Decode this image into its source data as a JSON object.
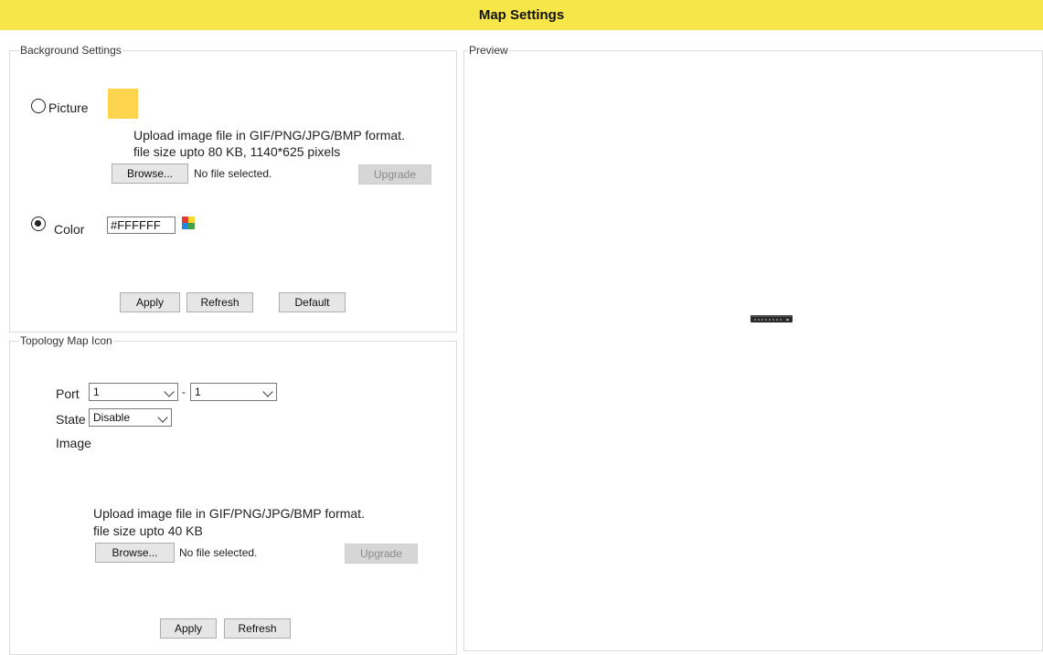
{
  "title": "Map Settings",
  "background": {
    "legend": "Background Settings",
    "picture_label": "Picture",
    "picture_swatch_color": "#ffd54f",
    "upload_note_line1": "Upload image file in GIF/PNG/JPG/BMP format.",
    "upload_note_line2": "file size upto 80 KB, 1140*625 pixels",
    "browse_label": "Browse...",
    "no_file_text": "No file selected.",
    "upgrade_label": "Upgrade",
    "color_label": "Color",
    "color_value": "#FFFFFF",
    "selected_option": "Color",
    "apply_label": "Apply",
    "refresh_label": "Refresh",
    "default_label": "Default"
  },
  "topology": {
    "legend": "Topology Map Icon",
    "port_label": "Port",
    "port_from": "1",
    "port_separator": "-",
    "port_to": "1",
    "state_label": "State",
    "state_value": "Disable",
    "image_label": "Image",
    "upload_note_line1": "Upload image file in GIF/PNG/JPG/BMP format.",
    "upload_note_line2": "file size upto 40 KB",
    "browse_label": "Browse...",
    "no_file_text": "No file selected.",
    "upgrade_label": "Upgrade",
    "apply_label": "Apply",
    "refresh_label": "Refresh"
  },
  "preview": {
    "legend": "Preview",
    "device_icon": "switch-device-icon"
  }
}
